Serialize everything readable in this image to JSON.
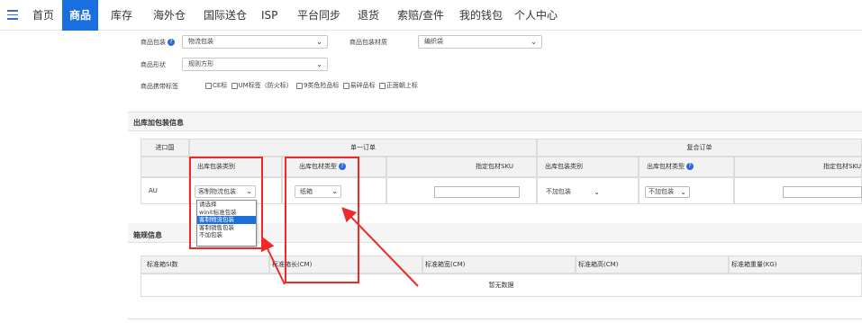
{
  "nav": {
    "items": [
      "首页",
      "商品",
      "库存",
      "海外仓",
      "国际送仓",
      "ISP",
      "平台同步",
      "退货",
      "索赔/查件",
      "我的钱包",
      "个人中心"
    ],
    "active_index": 1,
    "accent_color": "#1a6fe0"
  },
  "product": {
    "packaging_label": "商品包装",
    "packaging_value": "物流包装",
    "packaging_material_label": "商品包装材质",
    "packaging_material_value": "编织袋",
    "shape_label": "商品形状",
    "shape_value": "规则方形",
    "tags_label": "商品携带标签",
    "tags": [
      "CE标",
      "UM标签（防火标）",
      "9类危险品标",
      "易碎品标",
      "正面朝上标"
    ]
  },
  "outbound": {
    "section_title": "出库加包装信息",
    "country_header": "进口国",
    "single_order_header": "单一订单",
    "combined_order_header": "复合订单",
    "col_pack_category": "出库包装类别",
    "col_material_type": "出库包材类型",
    "col_sku": "指定包材SKU",
    "row": {
      "country": "AU",
      "single_pack_category": "客制物流包装",
      "single_material_type": "纸箱",
      "combined_pack_category": "不加包装",
      "combined_material_type": "不加包装"
    },
    "dropdown_options": [
      "请选择",
      "winit标准包装",
      "客制物流包装",
      "客制销售包装",
      "不加包装"
    ],
    "dropdown_selected_index": 2
  },
  "box": {
    "section_title": "箱规信息",
    "headers": [
      "标准箱SI数",
      "标准箱长(CM)",
      "标准箱宽(CM)",
      "标准箱高(CM)",
      "标准箱重量(KG)"
    ],
    "empty_text": "暂无数据"
  },
  "colors": {
    "annotation_red": "#ee2a2a"
  },
  "icons": {
    "help": "help-icon",
    "chevron": "chevron-down-icon",
    "menu": "hamburger-menu-icon"
  }
}
